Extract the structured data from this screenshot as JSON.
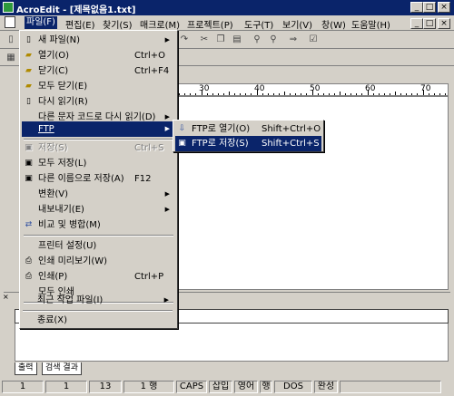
{
  "window": {
    "title": "AcroEdit - [제목없음1.txt]"
  },
  "menubar": {
    "items": [
      "파일(F)",
      "편집(E)",
      "찾기(S)",
      "매크로(M)",
      "프로젝트(P)",
      "도구(T)",
      "보기(V)",
      "창(W)",
      "도움말(H)"
    ],
    "active_index": 0
  },
  "ruler": {
    "labels": [
      "30",
      "40",
      "50",
      "60",
      "70"
    ]
  },
  "file_menu": {
    "items": [
      {
        "label": "새 파일(N)",
        "shortcut": "",
        "icon": "new-file-icon",
        "submenu": true
      },
      {
        "label": "열기(O)",
        "shortcut": "Ctrl+O",
        "icon": "open-folder-icon"
      },
      {
        "label": "닫기(C)",
        "shortcut": "Ctrl+F4",
        "icon": "close-file-icon"
      },
      {
        "label": "모두 닫기(E)",
        "shortcut": "",
        "icon": "close-all-icon"
      },
      {
        "label": "다시 읽기(R)",
        "shortcut": "",
        "icon": "reload-icon"
      },
      {
        "label": "다른 문자 코드로 다시 읽기(D)",
        "shortcut": "",
        "submenu": true
      },
      {
        "label": "FTP",
        "shortcut": "",
        "submenu": true,
        "highlighted": true
      },
      {
        "label": "저장(S)",
        "shortcut": "Ctrl+S",
        "icon": "save-icon",
        "disabled": true
      },
      {
        "label": "모두 저장(L)",
        "shortcut": "",
        "icon": "save-all-icon"
      },
      {
        "label": "다른 이름으로 저장(A)",
        "shortcut": "F12",
        "icon": "save-as-icon"
      },
      {
        "label": "변환(V)",
        "shortcut": "",
        "submenu": true
      },
      {
        "label": "내보내기(E)",
        "shortcut": "",
        "submenu": true
      },
      {
        "label": "비교 및 병합(M)",
        "shortcut": "",
        "icon": "compare-icon"
      },
      {
        "label": "프린터 설정(U)",
        "shortcut": ""
      },
      {
        "label": "인쇄 미리보기(W)",
        "shortcut": "",
        "icon": "print-preview-icon"
      },
      {
        "label": "인쇄(P)",
        "shortcut": "Ctrl+P",
        "icon": "print-icon"
      },
      {
        "label": "모두 인쇄",
        "shortcut": ""
      },
      {
        "label": "최근 작업 파일(I)",
        "shortcut": "",
        "submenu": true
      },
      {
        "label": "종료(X)",
        "shortcut": ""
      }
    ]
  },
  "ftp_submenu": {
    "items": [
      {
        "label": "FTP로 열기(O)",
        "shortcut": "Shift+Ctrl+O",
        "icon": "ftp-open-icon"
      },
      {
        "label": "FTP로 저장(S)",
        "shortcut": "Shift+Ctrl+S",
        "icon": "ftp-save-icon",
        "highlighted": true
      }
    ]
  },
  "output_panel": {
    "tabs": [
      "출력",
      "검색 결과"
    ]
  },
  "statusbar": {
    "cells": [
      "1",
      "1",
      "13",
      "1 행",
      "CAPS",
      "삽입",
      "영어",
      "행",
      "DOS",
      "완성"
    ]
  },
  "colors": {
    "highlight": "#0a246a",
    "face": "#d4d0c8"
  }
}
